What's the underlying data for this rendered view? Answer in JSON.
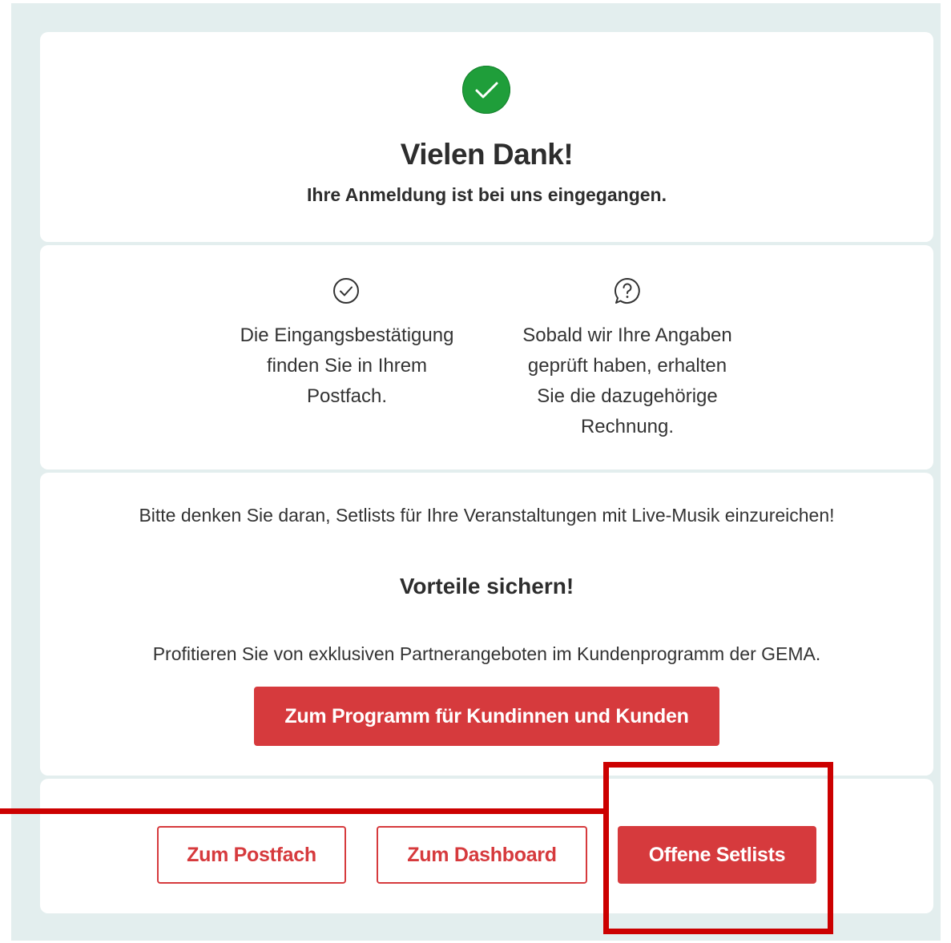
{
  "header": {
    "title": "Vielen Dank!",
    "subtitle": "Ihre Anmeldung ist bei uns eingegangen."
  },
  "info": {
    "col1": {
      "icon": "check-circle-icon",
      "lines": [
        "Die Eingangsbestätigung",
        "finden Sie in Ihrem",
        "Postfach."
      ]
    },
    "col2": {
      "icon": "question-bubble-icon",
      "lines": [
        "Sobald wir Ihre Angaben",
        "geprüft haben, erhalten",
        "Sie die dazugehörige",
        "Rechnung."
      ]
    }
  },
  "setlist_reminder": "Bitte denken Sie daran, Setlists für Ihre Veranstaltungen mit Live-Musik einzureichen!",
  "benefits": {
    "heading": "Vorteile sichern!",
    "text": "Profitieren Sie von exklusiven Partnerangeboten im Kundenprogramm der GEMA.",
    "button_label": "Zum Programm für Kundinnen und Kunden"
  },
  "actions": {
    "postfach_label": "Zum Postfach",
    "dashboard_label": "Zum Dashboard",
    "setlists_label": "Offene Setlists"
  },
  "colors": {
    "accent": "#d63a3d",
    "success": "#1f9e3a",
    "background": "#e3eeee",
    "highlight": "#cc0000"
  }
}
